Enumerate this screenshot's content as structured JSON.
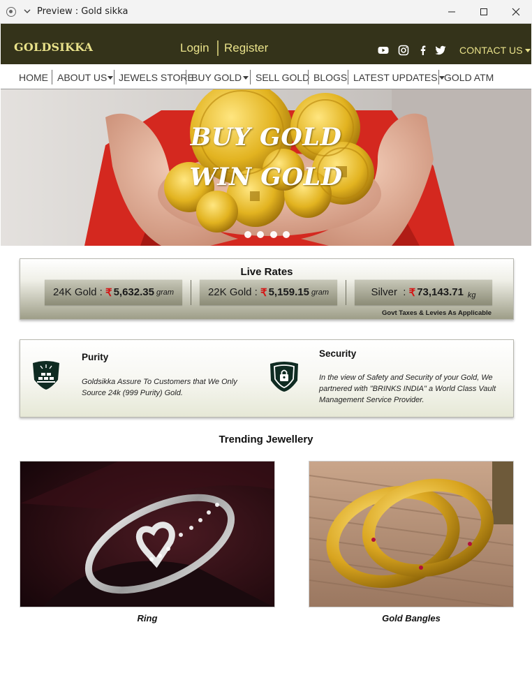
{
  "window": {
    "title": "Preview : Gold sikka"
  },
  "header": {
    "logo": "GOLDSIKKA",
    "login": "Login",
    "register": "Register",
    "contact": "CONTACT US",
    "social_icons": [
      "youtube-icon",
      "instagram-icon",
      "facebook-icon",
      "twitter-icon"
    ]
  },
  "nav": {
    "items": [
      {
        "label": "HOME",
        "dropdown": false
      },
      {
        "label": "ABOUT US",
        "dropdown": true
      },
      {
        "label": "JEWELS STORE",
        "dropdown": false
      },
      {
        "label": "BUY GOLD",
        "dropdown": true
      },
      {
        "label": "SELL GOLD",
        "dropdown": false
      },
      {
        "label": "BLOGS",
        "dropdown": false
      },
      {
        "label": "LATEST UPDATES",
        "dropdown": true
      },
      {
        "label": "GOLD ATM",
        "dropdown": false
      }
    ]
  },
  "hero": {
    "line1": "BUY GOLD",
    "line2": "WIN GOLD",
    "slide_count": 4,
    "active_slide": 3
  },
  "live_rates": {
    "title": "Live Rates",
    "rates": [
      {
        "label": "24K Gold :",
        "currency": "₹",
        "value": "5,632.35",
        "unit": "gram"
      },
      {
        "label": "22K Gold :",
        "currency": "₹",
        "value": "5,159.15",
        "unit": "gram"
      },
      {
        "label": "Silver  :",
        "currency": "₹",
        "value": "73,143.71",
        "unit": "kg"
      }
    ],
    "note": "Govt Taxes & Levies As Applicable"
  },
  "features": {
    "purity": {
      "title": "Purity",
      "description": "Goldsikka Assure To Customers that We Only Source 24k (999 Purity) Gold."
    },
    "security": {
      "title": "Security",
      "description": "In the view of Safety and Security of your Gold, We partnered with \"BRINKS INDIA\" a World Class Vault Management Service Provider."
    }
  },
  "trending": {
    "title": "Trending Jewellery",
    "products": [
      {
        "name": "Ring"
      },
      {
        "name": "Gold Bangles"
      }
    ]
  },
  "colors": {
    "header_bg": "#34331a",
    "header_text": "#e9e28a",
    "rupee": "#d41414",
    "icon_badge": "#0f2b22"
  }
}
